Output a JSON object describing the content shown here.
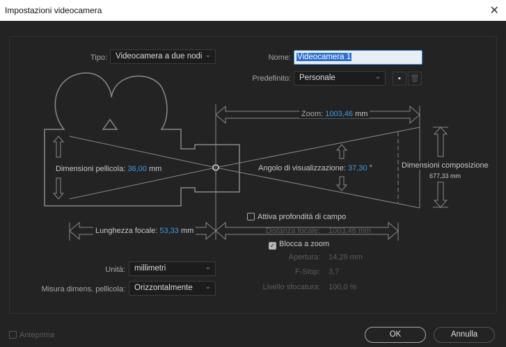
{
  "window": {
    "title": "Impostazioni videocamera",
    "close_icon": "close-icon"
  },
  "tipo": {
    "label": "Tipo:",
    "value": "Videocamera a due nodi"
  },
  "nome": {
    "label": "Nome:",
    "value": "Videocamera 1"
  },
  "predefinito": {
    "label": "Predefinito:",
    "value": "Personale"
  },
  "zoom": {
    "label": "Zoom:",
    "value": "1003,46",
    "unit": "mm"
  },
  "pellicola": {
    "label": "Dimensioni pellicola:",
    "value": "36,00",
    "unit": "mm"
  },
  "angolo": {
    "label": "Angolo di visualizzazione:",
    "value": "37,30",
    "unit": "°"
  },
  "composizione": {
    "label": "Dimensioni composizione",
    "value": "677,33 mm"
  },
  "lunghezza": {
    "label": "Lunghezza focale:",
    "value": "53,33",
    "unit": "mm"
  },
  "dof": {
    "label": "Attiva profondità di campo",
    "checked": false
  },
  "distanza": {
    "label": "Distanza focale:",
    "value": "1003,46 mm"
  },
  "blocca": {
    "label": "Blocca a zoom",
    "checked": true
  },
  "apertura": {
    "label": "Apertura:",
    "value": "14,29 mm"
  },
  "fstop": {
    "label": "F-Stop:",
    "value": "3,7"
  },
  "sfocatura": {
    "label": "Livello sfocatura:",
    "value": "100,0 %"
  },
  "unita": {
    "label": "Unità:",
    "value": "millimetri"
  },
  "misura": {
    "label": "Misura dimens. pellicola:",
    "value": "Orizzontalmente"
  },
  "anteprima": {
    "label": "Anteprima",
    "checked": false
  },
  "buttons": {
    "ok": "OK",
    "cancel": "Annulla"
  }
}
